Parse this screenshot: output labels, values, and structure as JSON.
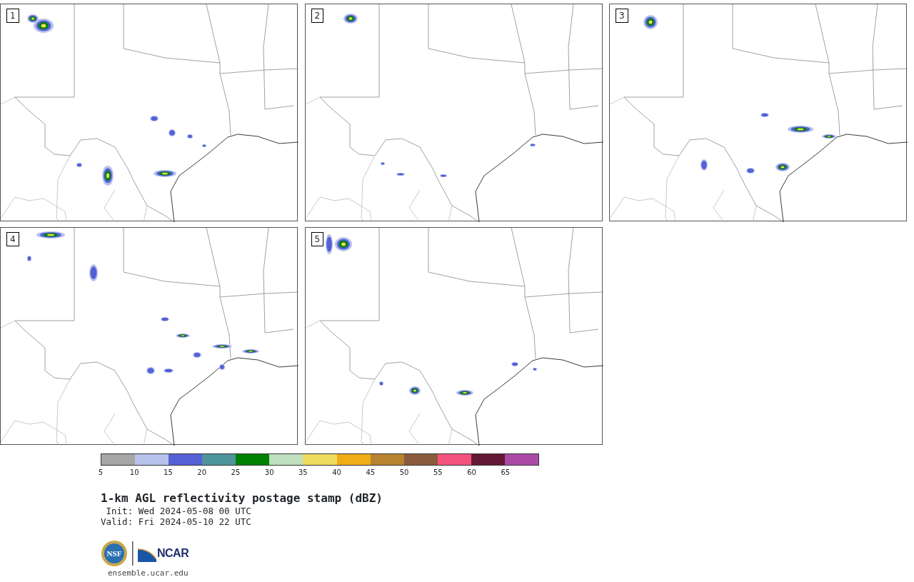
{
  "panels": [
    {
      "number": "1"
    },
    {
      "number": "2"
    },
    {
      "number": "3"
    },
    {
      "number": "4"
    },
    {
      "number": "5"
    }
  ],
  "colorbar": {
    "segments": [
      {
        "color": "#a6a6a6"
      },
      {
        "color": "#b8c2ec"
      },
      {
        "color": "#5461d6"
      },
      {
        "color": "#4e949c"
      },
      {
        "color": "#018101"
      },
      {
        "color": "#bfdfbe"
      },
      {
        "color": "#efdb5d"
      },
      {
        "color": "#efad17"
      },
      {
        "color": "#b8822f"
      },
      {
        "color": "#8a5b3d"
      },
      {
        "color": "#f4527f"
      },
      {
        "color": "#631935"
      },
      {
        "color": "#ab4ba5"
      }
    ],
    "ticks": [
      "5",
      "10",
      "15",
      "20",
      "25",
      "30",
      "35",
      "40",
      "45",
      "50",
      "55",
      "60",
      "65"
    ]
  },
  "title": "1-km AGL reflectivity postage stamp (dBZ)",
  "init": " Init: Wed 2024-05-08 00 UTC",
  "valid": "Valid: Fri 2024-05-10 22 UTC",
  "logos": {
    "nsf": "NSF",
    "ncar": "NCAR"
  },
  "url": "ensemble.ucar.edu"
}
